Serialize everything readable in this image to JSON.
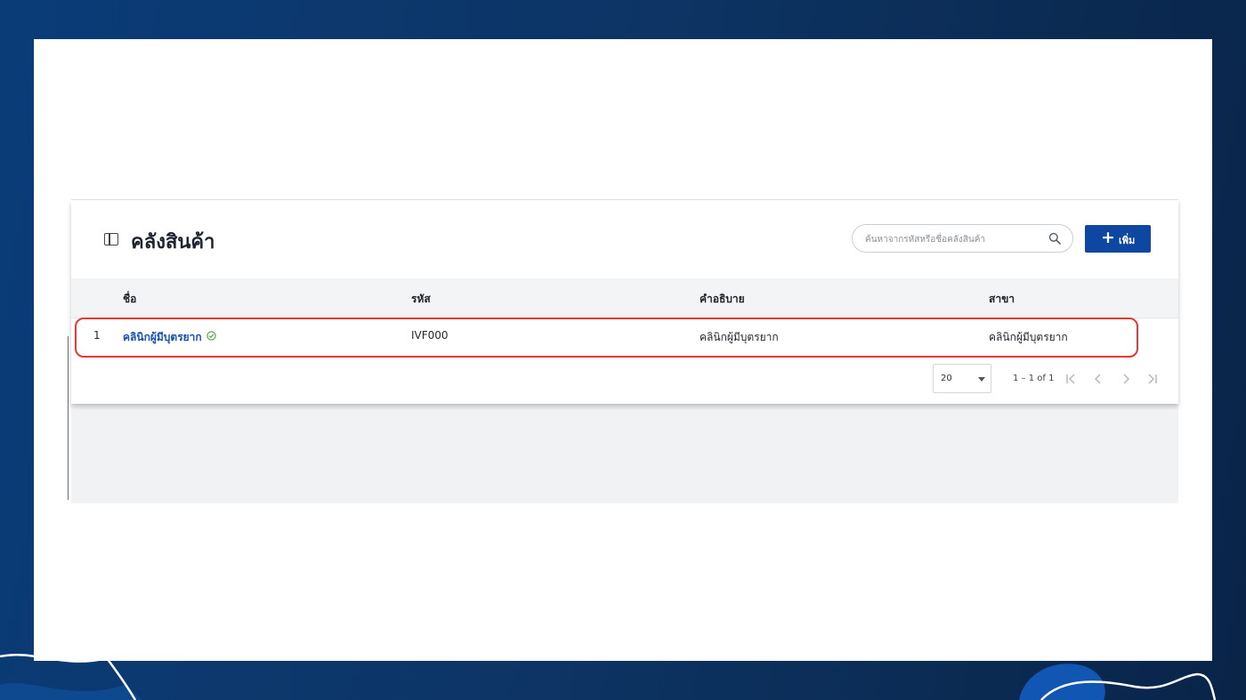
{
  "page": {
    "title": "คลังสินค้า",
    "title_icon": "book-panel-icon",
    "accent_color": "#0d47a1",
    "link_color": "#1650b4",
    "highlight_color": "#e53935"
  },
  "search": {
    "placeholder": "ค้นหาจากรหัสหรือชื่อคลังสินค้า",
    "icon": "search-icon"
  },
  "add_button": {
    "icon": "plus-icon",
    "label": "เพิ่ม"
  },
  "table": {
    "columns": [
      "ชื่อ",
      "รหัส",
      "คำอธิบาย",
      "สาขา"
    ],
    "rows": [
      {
        "index": "1",
        "name": "คลินิกผู้มีบุตรยาก",
        "status_icon": "check-circle-icon",
        "code": "IVF000",
        "description": "คลินิกผู้มีบุตรยาก",
        "branch": "คลินิกผู้มีบุตรยาก"
      }
    ]
  },
  "pagination": {
    "page_size": "20",
    "range_label": "1 – 1 of 1",
    "icons": [
      "first-page-icon",
      "prev-page-icon",
      "next-page-icon",
      "last-page-icon"
    ]
  }
}
